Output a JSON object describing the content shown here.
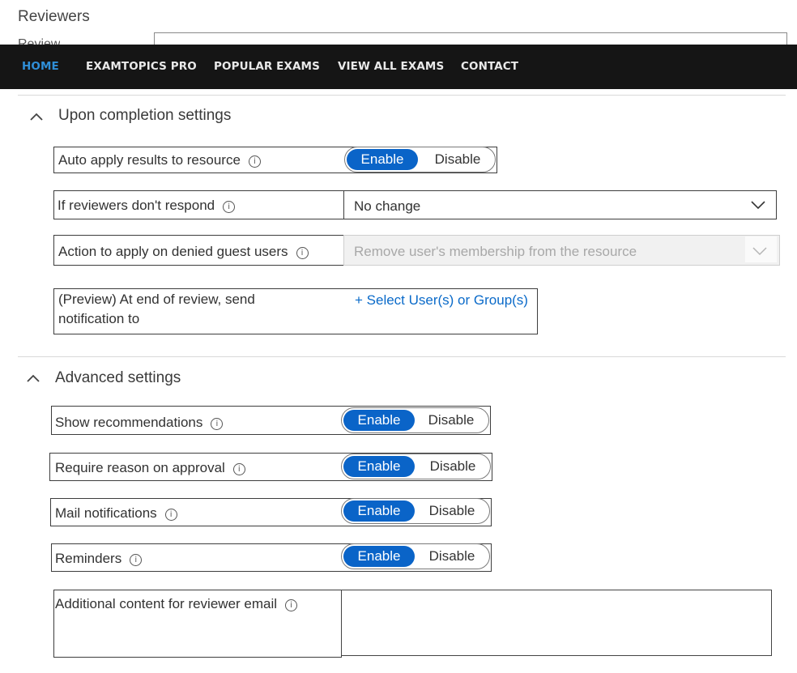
{
  "page": {
    "reviewers_title": "Reviewers",
    "partial_label": "Review"
  },
  "navbar": {
    "items": [
      {
        "label": "HOME",
        "active": true
      },
      {
        "label": "EXAMTOPICS PRO"
      },
      {
        "label": "POPULAR EXAMS"
      },
      {
        "label": "VIEW ALL EXAMS"
      },
      {
        "label": "CONTACT"
      }
    ]
  },
  "completion": {
    "title": "Upon completion settings",
    "auto_apply": {
      "label": "Auto apply results to resource",
      "enable": "Enable",
      "disable": "Disable",
      "value": "Enable"
    },
    "no_response": {
      "label": "If reviewers don't respond",
      "value": "No change"
    },
    "denied_guests": {
      "label": "Action to apply on denied guest users",
      "value": "Remove user's membership from the resource"
    },
    "notification": {
      "label_line1": "(Preview) At end of review, send",
      "label_line2": "notification to",
      "link": "+ Select User(s) or Group(s)"
    }
  },
  "advanced": {
    "title": "Advanced settings",
    "rows": [
      {
        "label": "Show recommendations",
        "enable": "Enable",
        "disable": "Disable",
        "value": "Enable"
      },
      {
        "label": "Require reason on approval",
        "enable": "Enable",
        "disable": "Disable",
        "value": "Enable"
      },
      {
        "label": "Mail notifications",
        "enable": "Enable",
        "disable": "Disable",
        "value": "Enable"
      },
      {
        "label": "Reminders",
        "enable": "Enable",
        "disable": "Disable",
        "value": "Enable"
      }
    ],
    "additional_content": {
      "label": "Additional content for reviewer email",
      "value": ""
    }
  },
  "colors": {
    "navbar_bg": "#151515",
    "nav_active": "#2f8fd8",
    "toggle_on": "#0a64c8",
    "link": "#0a6ac9"
  }
}
